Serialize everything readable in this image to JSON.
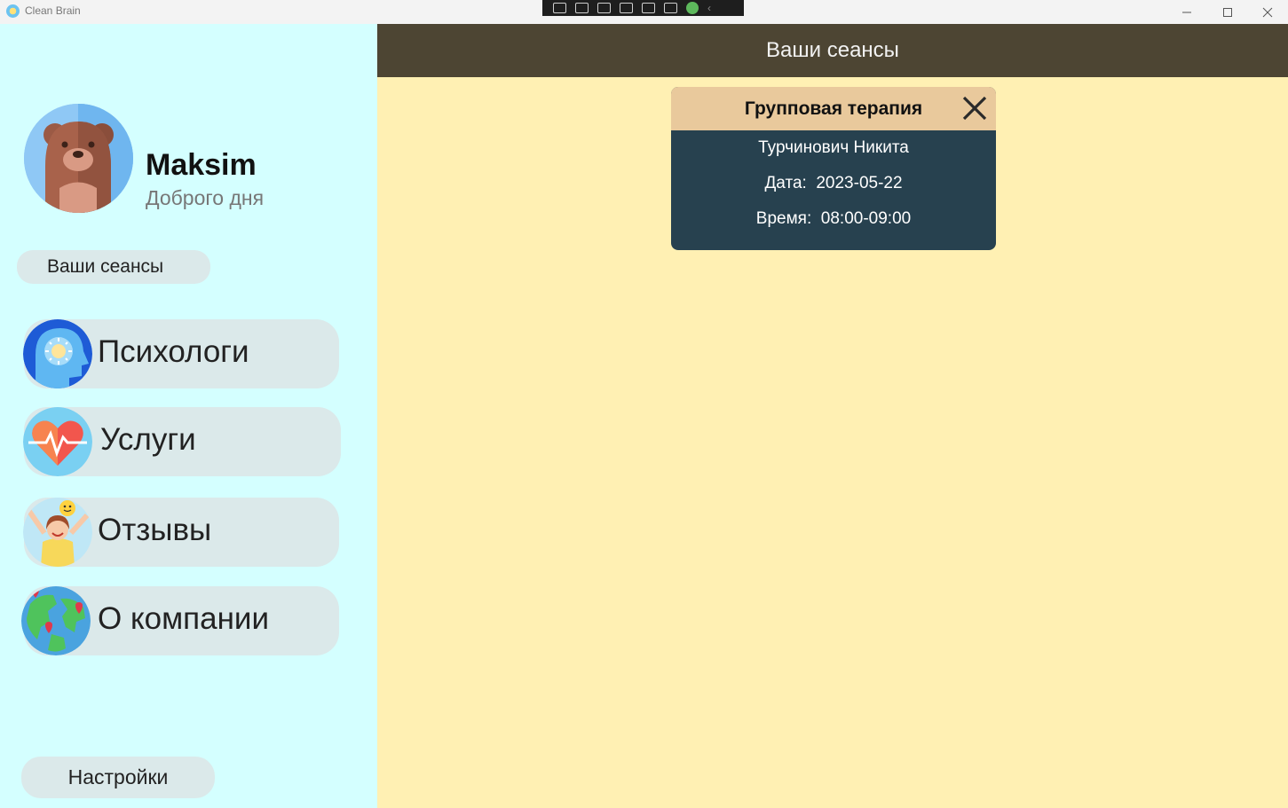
{
  "window": {
    "title": "Clean Brain"
  },
  "profile": {
    "name": "Maksim",
    "greeting": "Доброго дня"
  },
  "sidebar": {
    "sessions_label": "Ваши сеансы",
    "items": [
      {
        "label": "Психологи",
        "icon": "psychology-head-icon"
      },
      {
        "label": "Услуги",
        "icon": "heart-pulse-icon"
      },
      {
        "label": "Отзывы",
        "icon": "happy-person-icon"
      },
      {
        "label": "О компании",
        "icon": "globe-icon"
      }
    ],
    "settings_label": "Настройки"
  },
  "main": {
    "header_title": "Ваши сеансы",
    "session_card": {
      "title": "Групповая терапия",
      "therapist": "Турчинович Никита",
      "date_label": "Дата:",
      "date": "2023-05-22",
      "time_label": "Время:",
      "time": "08:00-09:00"
    }
  },
  "colors": {
    "sidebar_bg": "#d4ffff",
    "main_bg": "#fff0b3",
    "header_bg": "#4d4533",
    "card_head": "#e9c99c",
    "card_body": "#27414f",
    "nav_button": "#dbe9ea"
  }
}
